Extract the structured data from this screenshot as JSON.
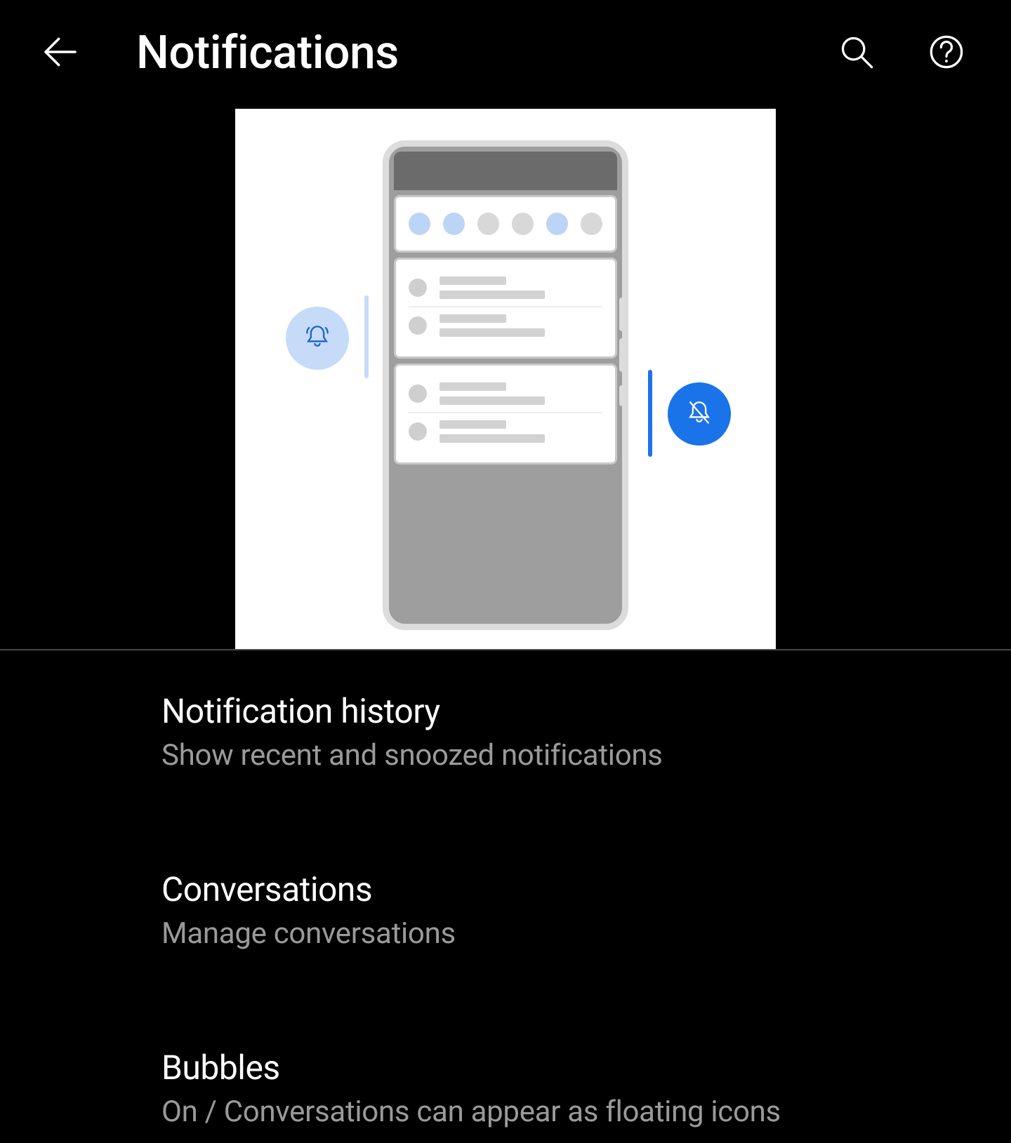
{
  "header": {
    "title": "Notifications"
  },
  "illustration": {
    "left_icon": "bell-ringing",
    "right_icon": "bell-off",
    "quick_settings_dots": [
      "blue",
      "blue",
      "grey",
      "grey",
      "blue",
      "grey"
    ]
  },
  "settings": [
    {
      "title": "Notification history",
      "subtitle": "Show recent and snoozed notifications"
    },
    {
      "title": "Conversations",
      "subtitle": "Manage conversations"
    },
    {
      "title": "Bubbles",
      "subtitle": "On / Conversations can appear as floating icons"
    }
  ]
}
